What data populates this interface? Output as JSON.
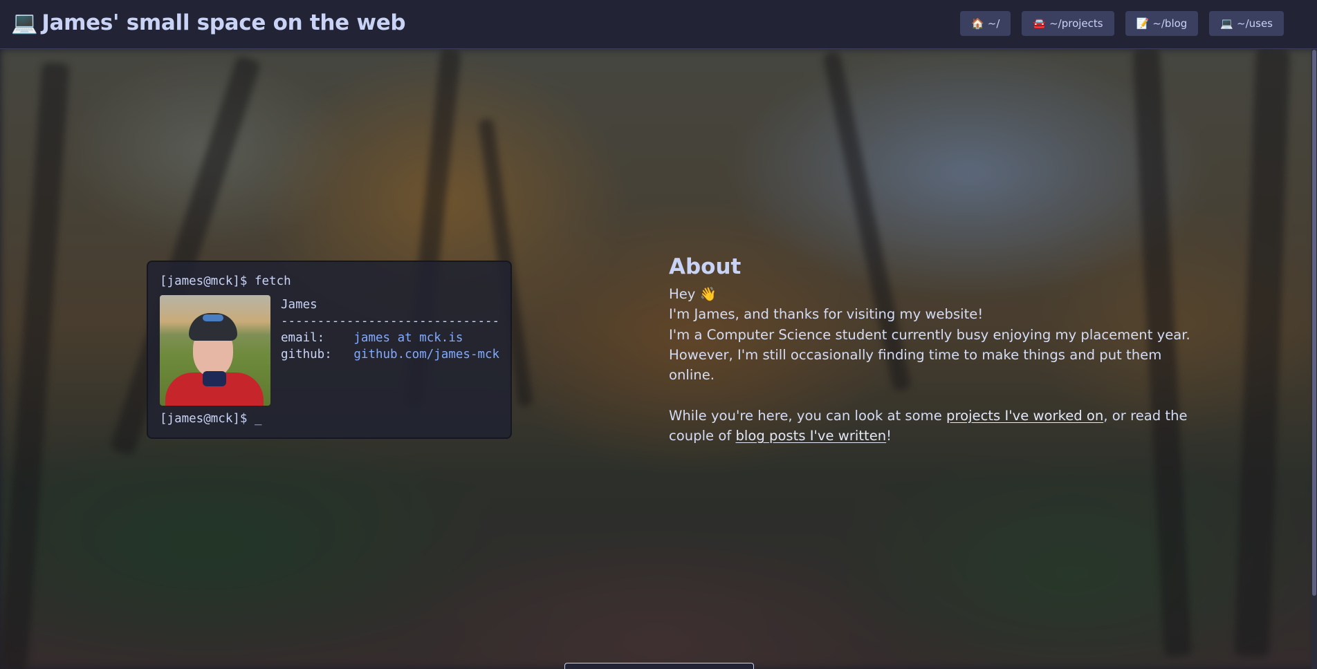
{
  "header": {
    "title_icon": "💻",
    "title": "James' small space on the web",
    "nav": [
      {
        "icon": "🏠",
        "label": "~/"
      },
      {
        "icon": "🚘",
        "label": "~/projects"
      },
      {
        "icon": "📝",
        "label": "~/blog"
      },
      {
        "icon": "💻",
        "label": "~/uses"
      }
    ]
  },
  "terminal": {
    "prompt_cmd": "[james@mck]$ fetch",
    "name": "James",
    "divider": "------------------------------",
    "email_key": "email:",
    "email_val": "james at mck.is",
    "github_key": "github:",
    "github_val": "github.com/james-mck",
    "prompt_end": "[james@mck]$ _"
  },
  "about": {
    "heading": "About",
    "hey": "Hey 👋",
    "line1": "I'm James, and thanks for visiting my website!",
    "line2": "I'm a Computer Science student currently busy enjoying my placement year. However, I'm still occasionally finding time to make things and put them online.",
    "p2_before": "While you're here, you can look at some ",
    "projects_link": "projects I've worked on",
    "p2_middle": ", or read the couple of ",
    "blog_link": "blog posts I've written",
    "p2_after": "!"
  },
  "colors": {
    "header_bg": "#222436",
    "nav_button_bg": "#3b4061",
    "text": "#c8d3f5",
    "link_blue": "#82aaff"
  }
}
